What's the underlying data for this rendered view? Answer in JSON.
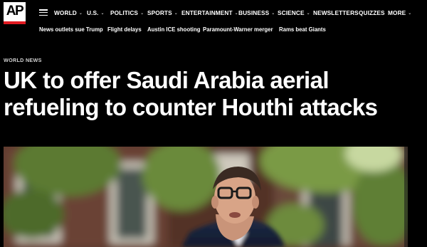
{
  "brand": {
    "logo_text": "AP",
    "accent": "#e11b22"
  },
  "nav": {
    "menu_icon": "hamburger-icon",
    "items": [
      {
        "label": "WORLD",
        "dropdown": true
      },
      {
        "label": "U.S.",
        "dropdown": true
      },
      {
        "label": "POLITICS",
        "dropdown": true
      },
      {
        "label": "SPORTS",
        "dropdown": true
      },
      {
        "label": "ENTERTAINMENT",
        "dropdown": true
      },
      {
        "label": "BUSINESS",
        "dropdown": true
      },
      {
        "label": "SCIENCE",
        "dropdown": true
      },
      {
        "label": "NEWSLETTERS",
        "dropdown": false
      },
      {
        "label": "QUIZZES",
        "dropdown": false
      },
      {
        "label": "MORE",
        "dropdown": true
      }
    ]
  },
  "trending": [
    "News outlets sue Trump",
    "Flight delays",
    "Austin ICE shooting",
    "Paramount-Warner merger",
    "Rams beat Giants"
  ],
  "article": {
    "section": "WORLD NEWS",
    "headline_line1": "UK to offer Saudi Arabia aerial",
    "headline_line2": "refueling to counter Houthi attacks"
  },
  "hero_image": {
    "description_icon": "news-photo"
  }
}
